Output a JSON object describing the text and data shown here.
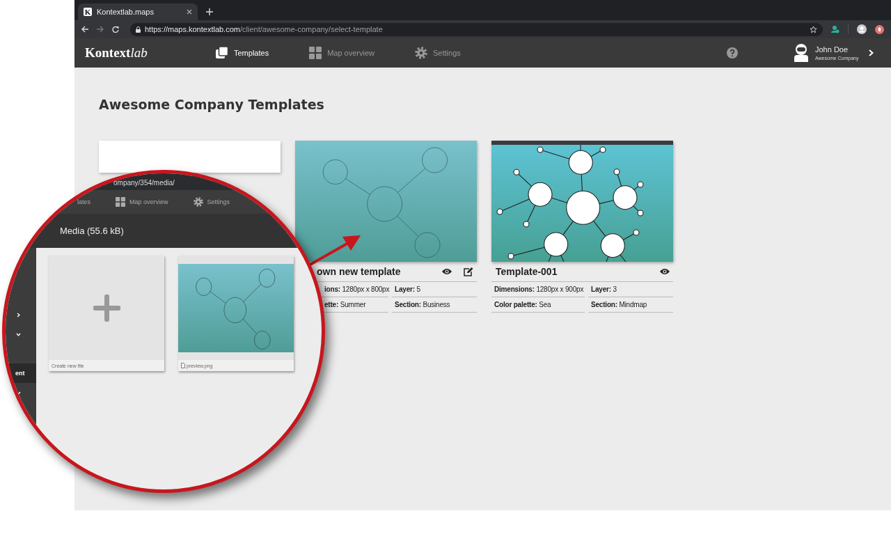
{
  "browser": {
    "tab_favicon": "K",
    "tab_title": "Kontextlab.maps",
    "url_host": "https://maps.kontextlab.com",
    "url_path": "/client/awesome-company/select-template"
  },
  "app_nav": {
    "logo": {
      "strong": "Kontext",
      "light": "lab"
    },
    "items": [
      {
        "kind": "templates",
        "label": "Templates",
        "selected": true
      },
      {
        "kind": "overview",
        "label": "Map overview",
        "selected": false
      },
      {
        "kind": "settings",
        "label": "Settings",
        "selected": false
      }
    ]
  },
  "user": {
    "name": "John Doe",
    "company": "Awesome Company"
  },
  "page": {
    "title": "Awesome Company Templates"
  },
  "cards": [
    {
      "kind": "blank"
    },
    {
      "kind": "template",
      "title": "own new template",
      "editable": true,
      "map": {
        "kind": "starter"
      },
      "fields": [
        "**ions:** 1280px x 800px",
        "**Layer:** 5",
        "**ette:** Summer",
        "**Section:** Business"
      ]
    },
    {
      "kind": "template",
      "title": "Template-001",
      "editable": false,
      "map": {
        "kind": "mindmap"
      },
      "fields": [
        "**Dimensions:** 1280px x 900px",
        "**Layer:** 3",
        "**Color palette:** Sea",
        "**Section:** Mindmap"
      ]
    }
  ],
  "magnifier": {
    "url_fragment": "ompany/354/media/",
    "nav": [
      {
        "kind": "templates",
        "label": "lates"
      },
      {
        "kind": "overview",
        "label": "Map overview"
      },
      {
        "kind": "settings",
        "label": "Settings"
      }
    ],
    "header": "Media (55.6 kB)",
    "sidebar": [
      {
        "kind": "expand",
        "selected": false
      },
      {
        "kind": "collapse",
        "selected": false
      },
      {
        "kind": "label",
        "label": "ent",
        "selected": true
      },
      {
        "kind": "collapse",
        "selected": false
      }
    ],
    "files": [
      {
        "kind": "new",
        "label": "Create new file"
      },
      {
        "kind": "image",
        "label": "preview.png"
      }
    ]
  }
}
